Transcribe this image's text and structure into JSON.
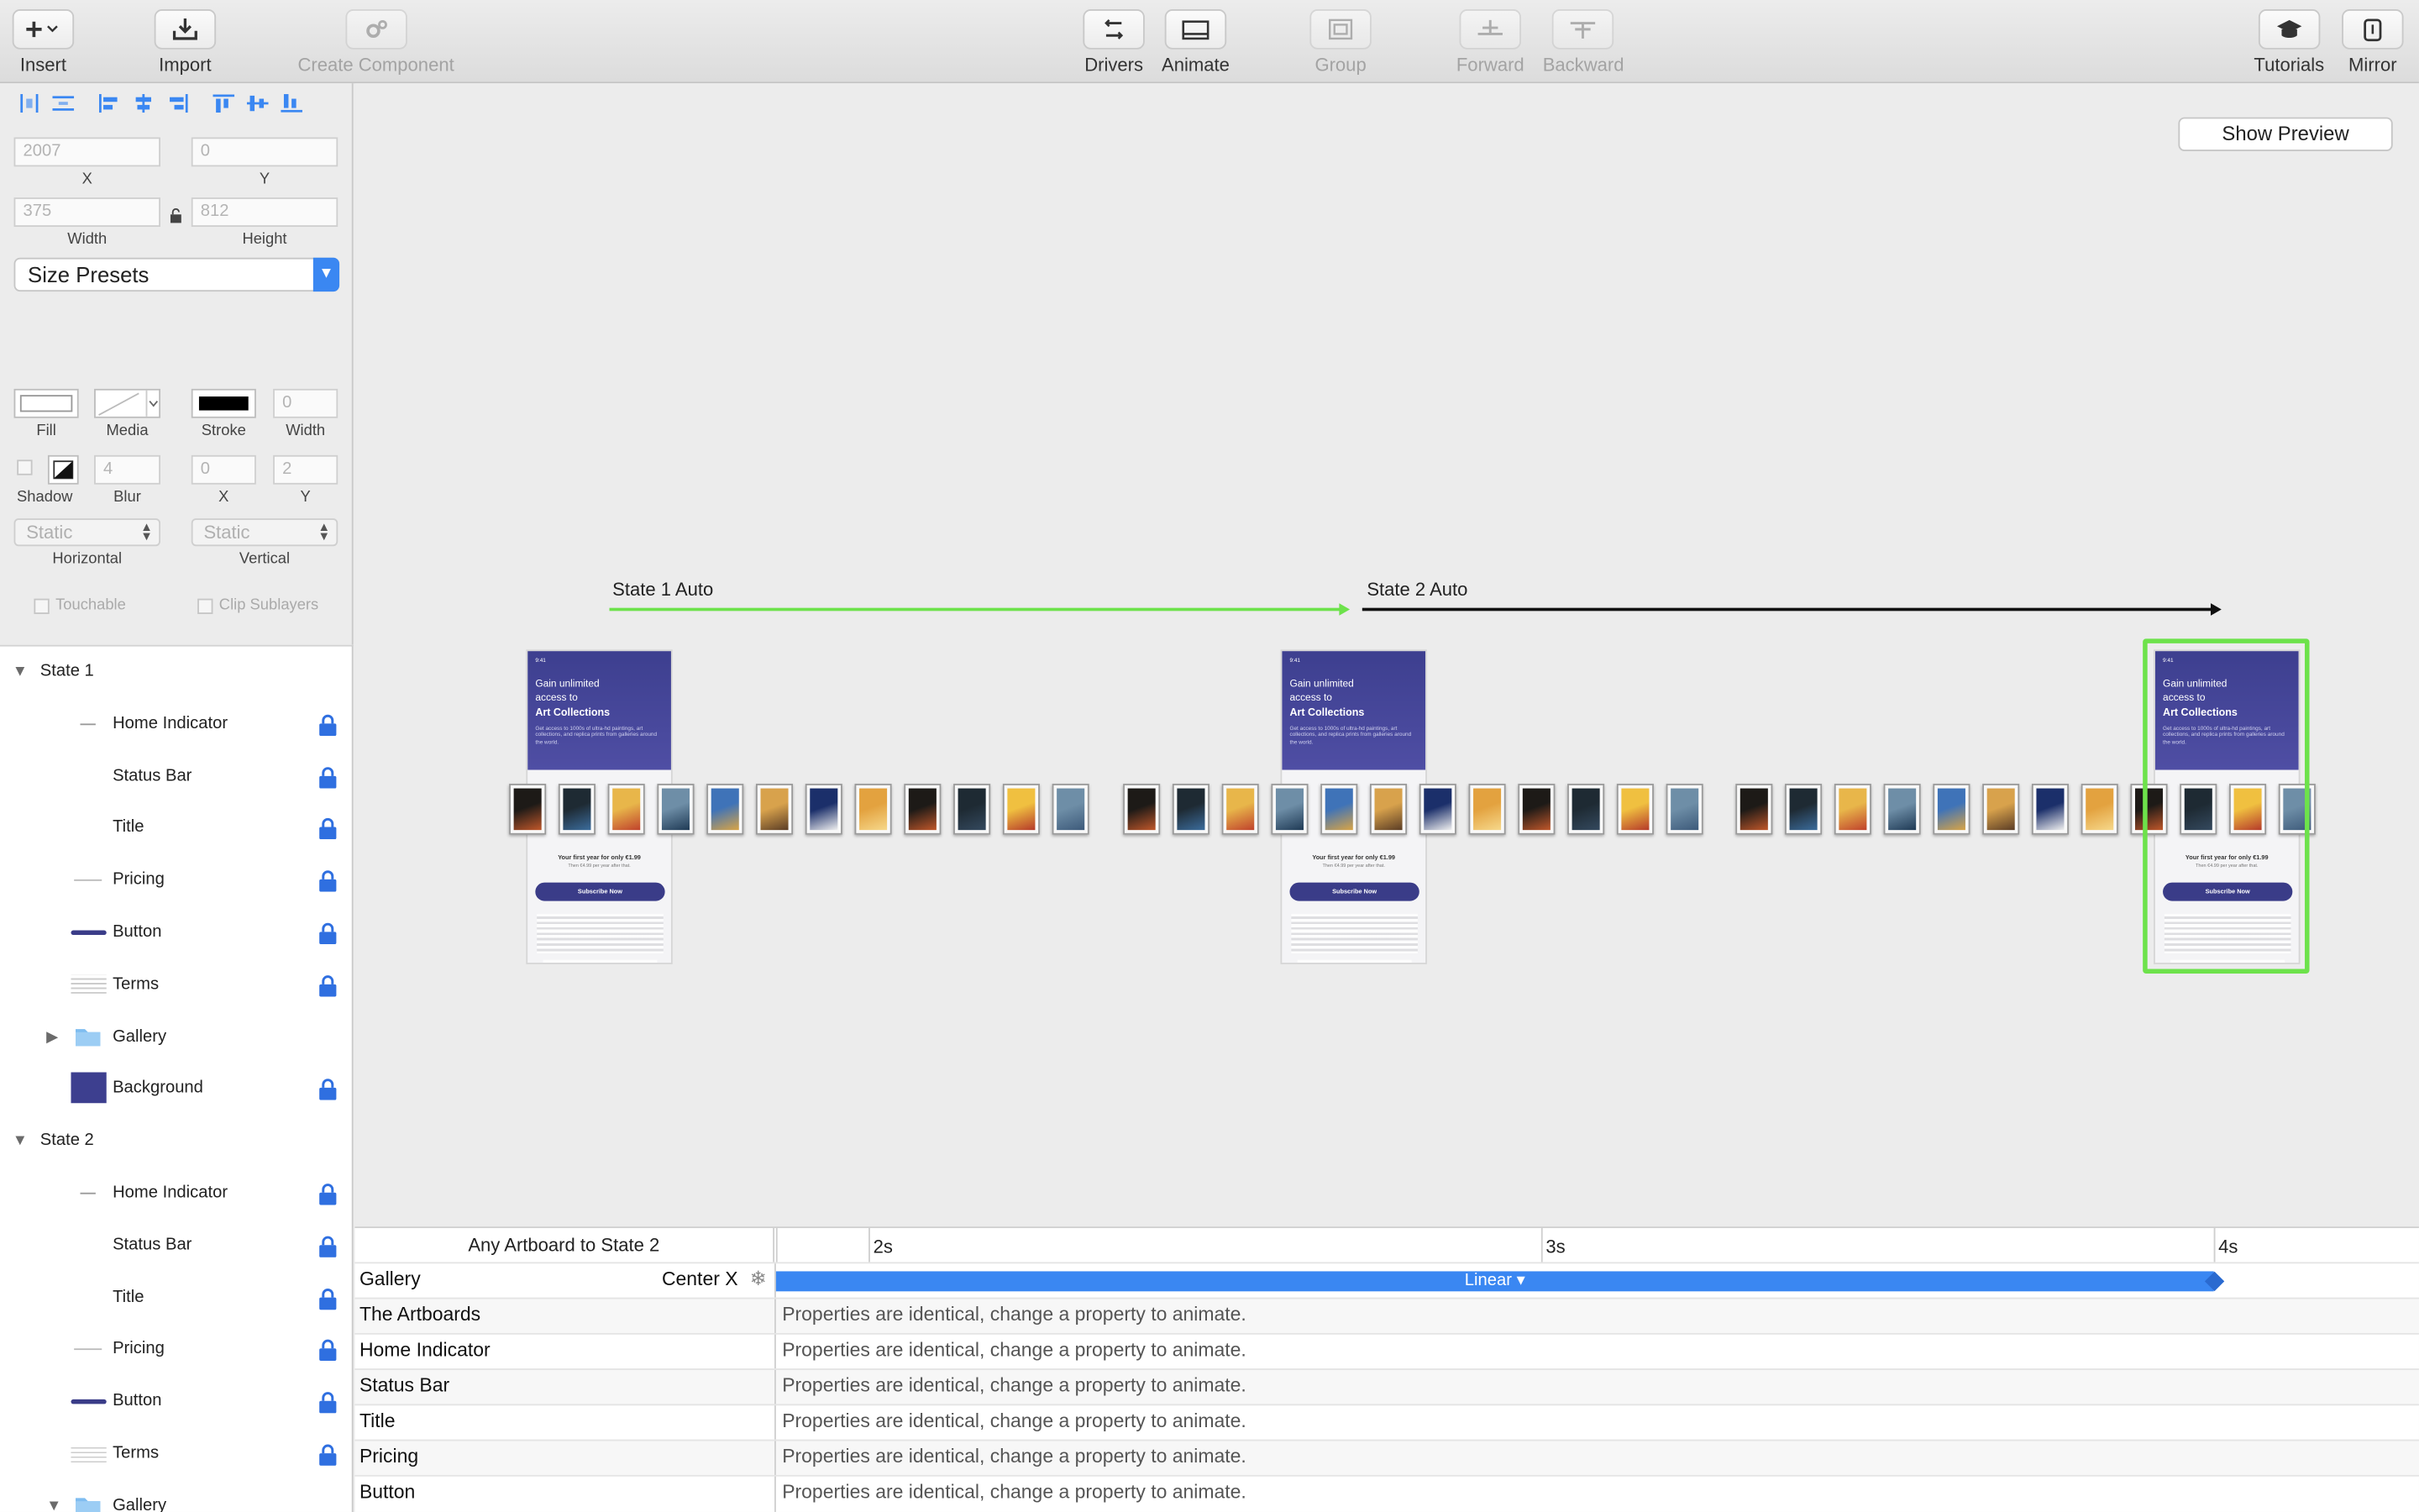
{
  "toolbar": {
    "insert": "Insert",
    "import": "Import",
    "create_component": "Create Component",
    "drivers": "Drivers",
    "animate": "Animate",
    "group": "Group",
    "forward": "Forward",
    "backward": "Backward",
    "tutorials": "Tutorials",
    "mirror": "Mirror"
  },
  "inspector": {
    "x_value": "2007",
    "y_value": "0",
    "x_label": "X",
    "y_label": "Y",
    "width_value": "375",
    "height_value": "812",
    "width_label": "Width",
    "height_label": "Height",
    "size_presets": "Size Presets",
    "fill_label": "Fill",
    "media_label": "Media",
    "stroke_label": "Stroke",
    "stroke_width_value": "0",
    "stroke_width_label": "Width",
    "shadow_label": "Shadow",
    "blur_value": "4",
    "blur_label": "Blur",
    "shadow_x_value": "0",
    "shadow_x_label": "X",
    "shadow_y_value": "2",
    "shadow_y_label": "Y",
    "horizontal_value": "Static",
    "horizontal_label": "Horizontal",
    "vertical_value": "Static",
    "vertical_label": "Vertical",
    "touchable": "Touchable",
    "clip_sublayers": "Clip Sublayers"
  },
  "layers": {
    "state1": "State 1",
    "state2": "State 2",
    "home_indicator": "Home Indicator",
    "status_bar": "Status Bar",
    "title": "Title",
    "pricing": "Pricing",
    "button": "Button",
    "terms": "Terms",
    "gallery": "Gallery",
    "background": "Background"
  },
  "canvas": {
    "show_preview": "Show Preview",
    "state1_auto": "State 1 Auto",
    "state2_auto": "State 2 Auto",
    "accent_green": "#6de24b",
    "phone": {
      "status_time": "9:41",
      "headline_line1": "Gain unlimited",
      "headline_line2": "access to",
      "headline_bold": "Art Collections",
      "body": "Get access to 1000s of ultra-hd paintings, art collections, and replica prints from galleries around the world.",
      "price": "Your first year for only €1.99",
      "price_sub": "Then €4.99 per year after that.",
      "subscribe": "Subscribe Now"
    }
  },
  "timeline": {
    "header": "Any Artboard to State 2",
    "tick_2s": "2s",
    "tick_3s": "3s",
    "tick_4s": "4s",
    "gallery_row": "Gallery",
    "gallery_prop": "Center X",
    "curve": "Linear ▾",
    "rows": [
      "The Artboards",
      "Home Indicator",
      "Status Bar",
      "Title",
      "Pricing",
      "Button"
    ],
    "identical_msg": "Properties are identical, change a property to animate.",
    "accent_blue": "#3a87f2"
  }
}
